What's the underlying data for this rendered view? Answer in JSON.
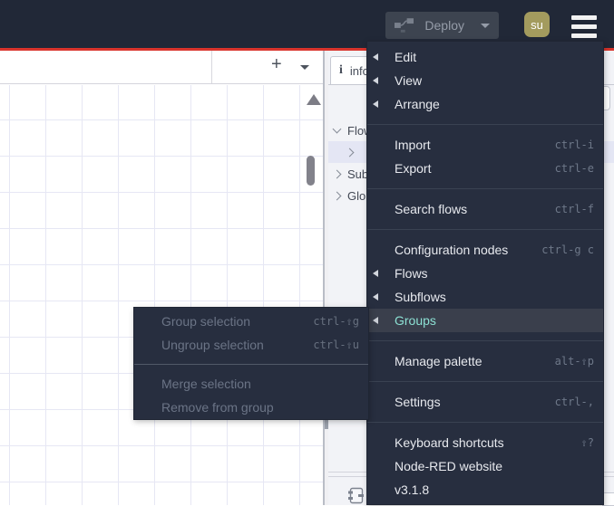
{
  "header": {
    "deploy_label": "Deploy",
    "avatar_initials": "su"
  },
  "canvas_toolbar": {
    "add_label": "+"
  },
  "sidebar": {
    "info_tab_icon": "i",
    "info_tab_label": "info",
    "outline": [
      {
        "label": "Flows"
      },
      {
        "label": ""
      },
      {
        "label": "Subflows"
      },
      {
        "label": "Global Configuration Nodes"
      }
    ]
  },
  "menu": {
    "sections": [
      {
        "items": [
          {
            "label": "Edit"
          },
          {
            "label": "View"
          },
          {
            "label": "Arrange"
          }
        ]
      },
      {
        "items": [
          {
            "label": "Import",
            "shortcut": "ctrl-i"
          },
          {
            "label": "Export",
            "shortcut": "ctrl-e"
          }
        ]
      },
      {
        "items": [
          {
            "label": "Search flows",
            "shortcut": "ctrl-f"
          }
        ]
      },
      {
        "items": [
          {
            "label": "Configuration nodes",
            "shortcut": "ctrl-g c"
          },
          {
            "label": "Flows"
          },
          {
            "label": "Subflows"
          },
          {
            "label": "Groups"
          }
        ]
      },
      {
        "items": [
          {
            "label": "Manage palette",
            "shortcut": "alt-⇧p"
          }
        ]
      },
      {
        "items": [
          {
            "label": "Settings",
            "shortcut": "ctrl-,"
          }
        ]
      },
      {
        "items": [
          {
            "label": "Keyboard shortcuts",
            "shortcut": "⇧?"
          },
          {
            "label": "Node-RED website"
          },
          {
            "label": "v3.1.8"
          }
        ]
      }
    ]
  },
  "submenu": {
    "sections": [
      {
        "items": [
          {
            "label": "Group selection",
            "shortcut": "ctrl-⇧g"
          },
          {
            "label": "Ungroup selection",
            "shortcut": "ctrl-⇧u"
          }
        ]
      },
      {
        "items": [
          {
            "label": "Merge selection"
          },
          {
            "label": "Remove from group"
          }
        ]
      }
    ]
  },
  "colors": {
    "header_bg": "#212837",
    "accent_red": "#d9342c",
    "menu_bg": "#272e3f",
    "menu_active_text": "#8ce0d3",
    "avatar_bg": "#a39b5e",
    "selected_row_bg": "#e4e6f4"
  }
}
